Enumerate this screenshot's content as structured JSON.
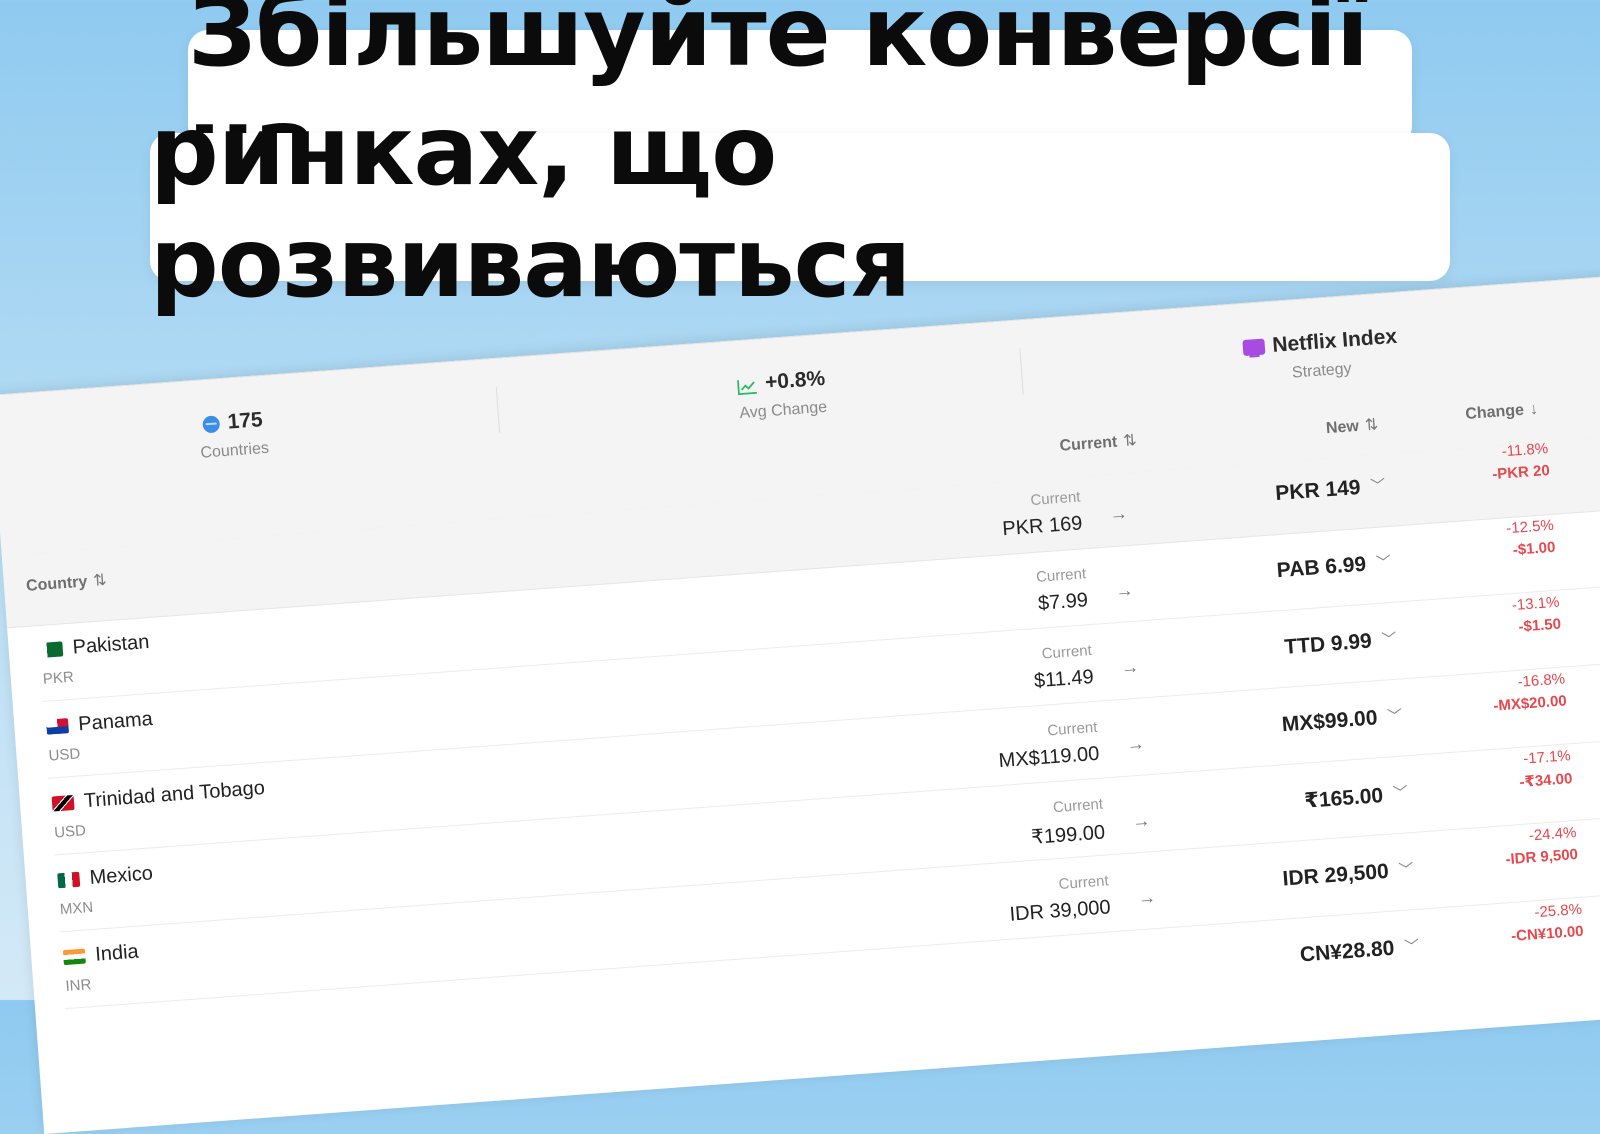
{
  "headline": {
    "line1": "Збільшуйте конверсії на",
    "line2": "ринках, що розвиваються"
  },
  "stats": {
    "countries": {
      "value": "175",
      "label": "Countries",
      "icon": "globe-icon"
    },
    "avg_change": {
      "value": "+0.8%",
      "label": "Avg Change",
      "icon": "trend-chart-icon"
    },
    "strategy": {
      "value": "Netflix Index",
      "label": "Strategy",
      "icon": "tv-icon"
    }
  },
  "columns": {
    "country": "Country",
    "current": "Current",
    "new": "New",
    "change": "Change",
    "sort_glyph": "⇅",
    "sort_desc_glyph": "↓"
  },
  "rows": [
    {
      "country": "Pakistan",
      "code": "PKR",
      "current_label": "Current",
      "current": "PKR 169",
      "new": "PKR 149",
      "change_pct": "-11.8%",
      "change_amt": "-PKR 20"
    },
    {
      "country": "Panama",
      "code": "USD",
      "current_label": "Current",
      "current": "$7.99",
      "new": "PAB 6.99",
      "change_pct": "-12.5%",
      "change_amt": "-$1.00"
    },
    {
      "country": "Trinidad and Tobago",
      "code": "USD",
      "current_label": "Current",
      "current": "$11.49",
      "new": "TTD 9.99",
      "change_pct": "-13.1%",
      "change_amt": "-$1.50"
    },
    {
      "country": "Mexico",
      "code": "MXN",
      "current_label": "Current",
      "current": "MX$119.00",
      "new": "MX$99.00",
      "change_pct": "-16.8%",
      "change_amt": "-MX$20.00"
    },
    {
      "country": "India",
      "code": "INR",
      "current_label": "Current",
      "current": "₹199.00",
      "new": "₹165.00",
      "change_pct": "-17.1%",
      "change_amt": "-₹34.00"
    },
    {
      "country": "",
      "code": "",
      "current_label": "Current",
      "current": "IDR 39,000",
      "new": "IDR 29,500",
      "change_pct": "-24.4%",
      "change_amt": "-IDR 9,500"
    },
    {
      "country": "",
      "code": "",
      "current_label": "",
      "current": "",
      "new": "CN¥28.80",
      "change_pct": "-25.8%",
      "change_amt": "-CN¥10.00"
    }
  ],
  "colors": {
    "negative": "#e5484d",
    "accent_tv": "#a84be0",
    "globe": "#3a8ee6",
    "chart": "#2fb86a"
  }
}
